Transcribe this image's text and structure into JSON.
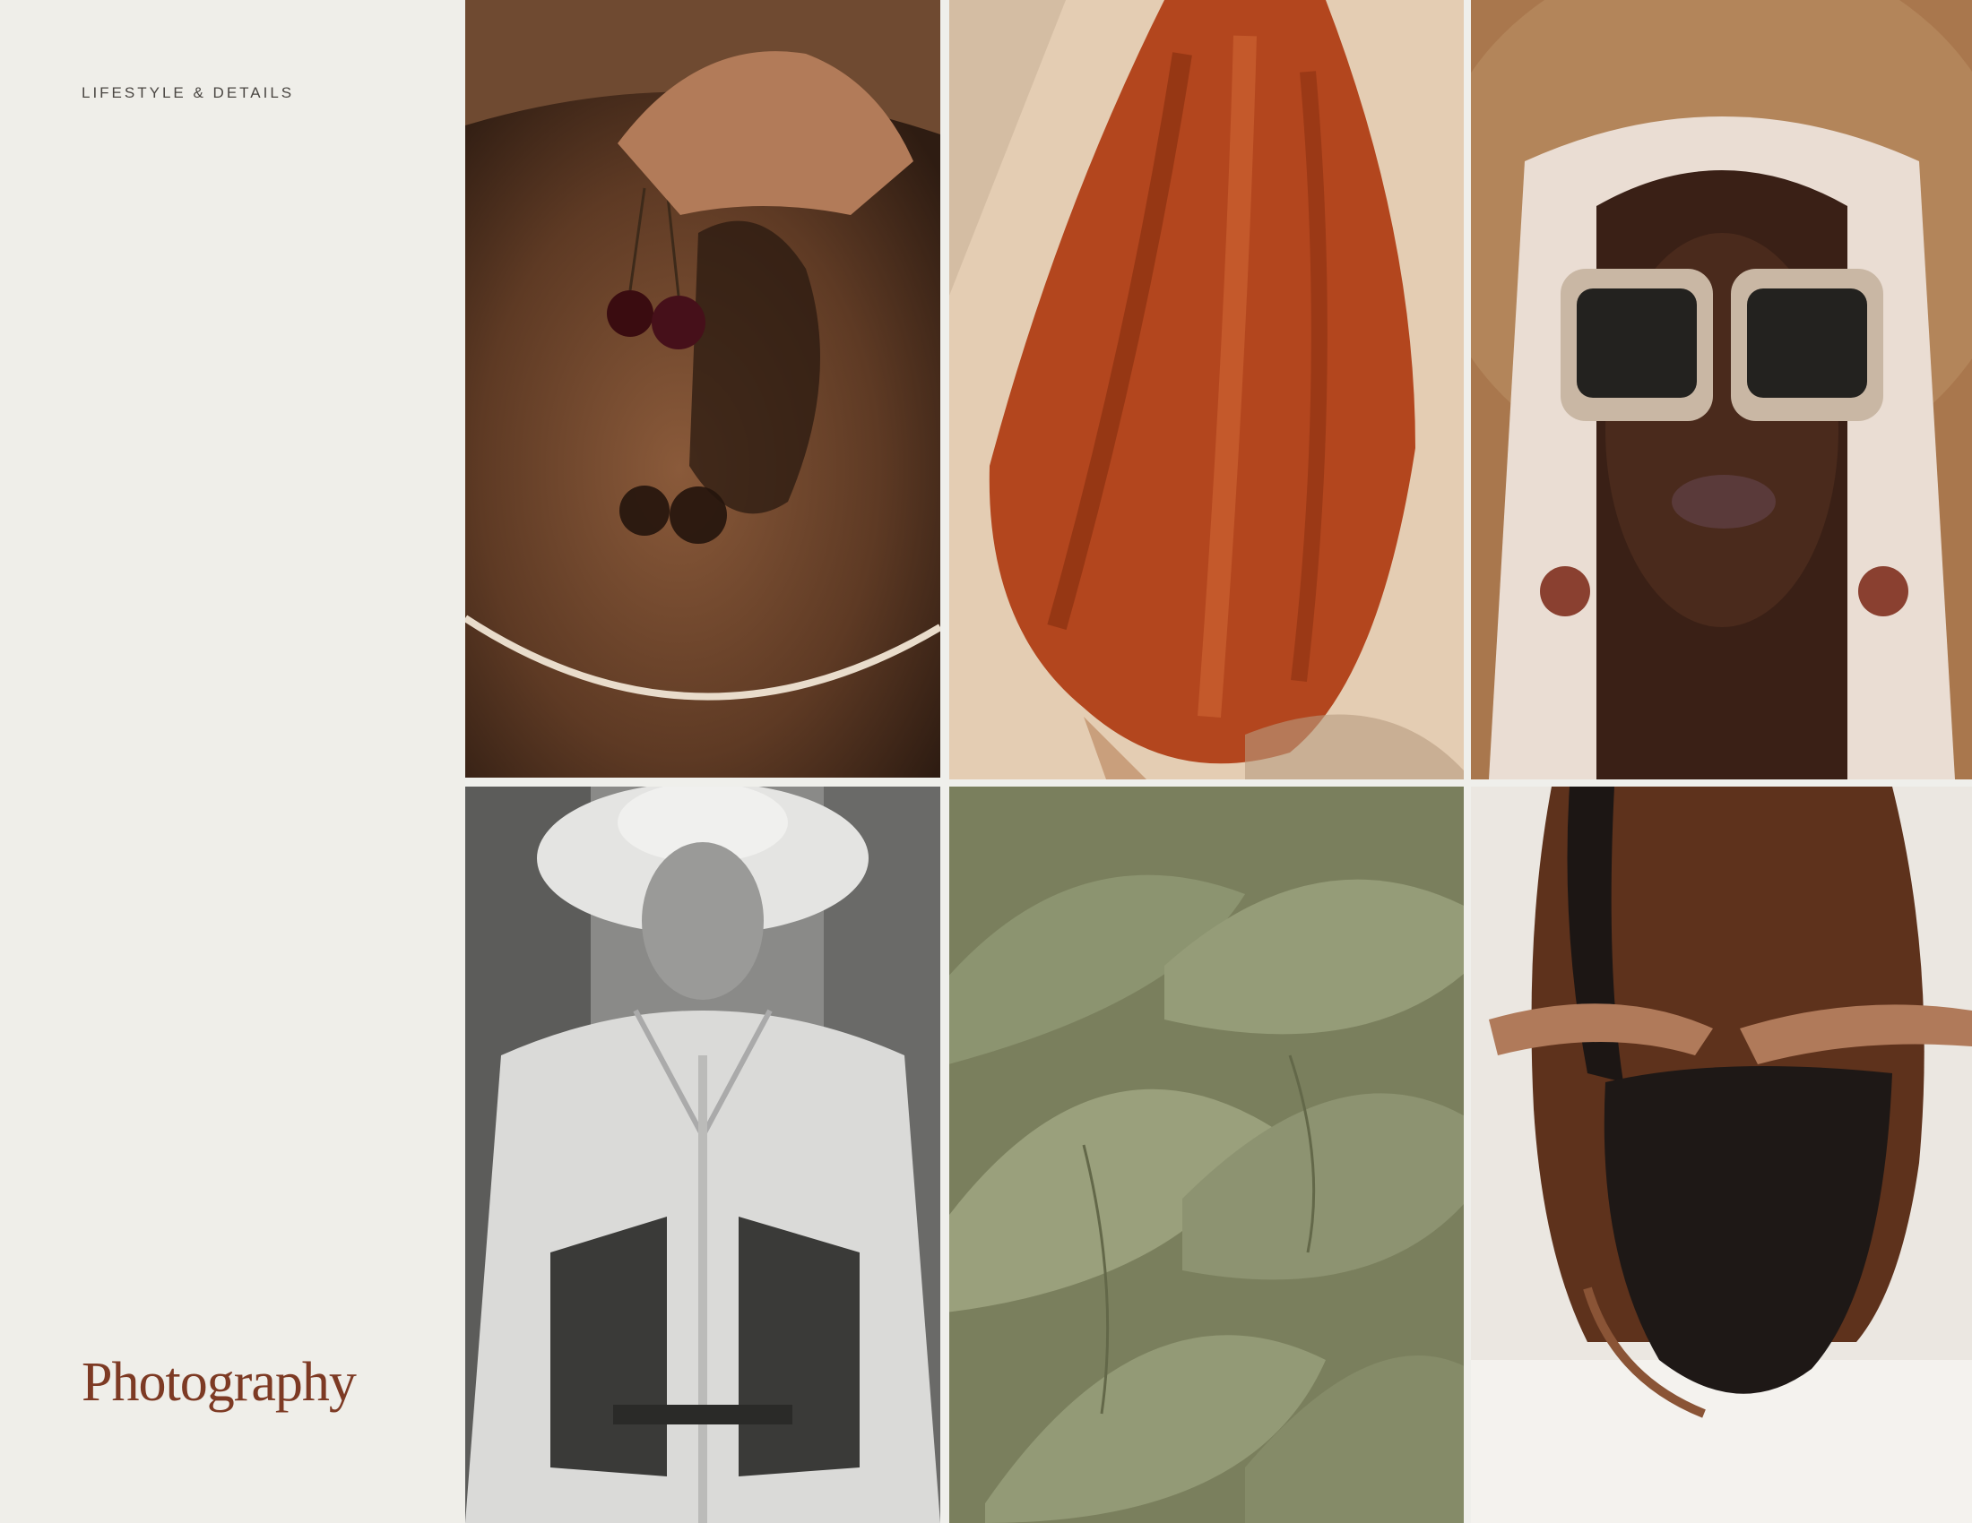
{
  "section_label": "LIFESTYLE & DETAILS",
  "page_title": "Photography",
  "colors": {
    "background": "#efeee9",
    "title": "#7d3a24",
    "label": "#4a4642"
  },
  "photos": [
    {
      "subject": "cherries-shadow"
    },
    {
      "subject": "rust-dress"
    },
    {
      "subject": "sunglasses-portrait"
    },
    {
      "subject": "hat-portrait-bw"
    },
    {
      "subject": "ginkgo-leaves"
    },
    {
      "subject": "swimsuit-back"
    }
  ]
}
